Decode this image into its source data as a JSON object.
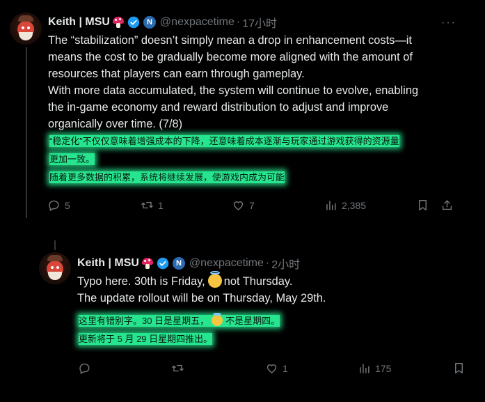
{
  "tweets": [
    {
      "author": {
        "name": "Keith | MSU",
        "handle": "@nexpacetime",
        "separator": "·",
        "time": "17小时",
        "app_badge_letter": "N"
      },
      "body_lines": [
        "The “stabilization” doesn’t simply mean a drop in enhancement costs—it",
        "means the cost to be gradually become more aligned with the amount of",
        "resources that players can earn through gameplay.",
        "With more data accumulated, the system will continue to evolve, enabling",
        "the in-game economy and reward distribution to adjust and improve",
        "organically over time. (7/8)"
      ],
      "translation_lines": [
        "“稳定化”不仅仅意味着增强成本的下降，还意味着成本逐渐与玩家通过游戏获得的资源量",
        "更加一致。",
        "随着更多数据的积累，系统将继续发展，使游戏内成为可能"
      ],
      "actions": {
        "reply": "5",
        "retweet": "1",
        "like": "7",
        "views": "2,385"
      }
    },
    {
      "author": {
        "name": "Keith | MSU",
        "handle": "@nexpacetime",
        "separator": "·",
        "time": "2小时",
        "app_badge_letter": "N"
      },
      "body_part1": "Typo here. 30th is Friday,",
      "body_part2": "not Thursday.",
      "body_line2": "The update rollout will be on Thursday, May 29th.",
      "translation_part1": "这里有错别字。30 日是星期五，",
      "translation_part2": "不是星期四。",
      "translation_line2": "更新将于 5 月 29 日星期四推出。",
      "actions": {
        "reply": "",
        "retweet": "",
        "like": "1",
        "views": "175"
      }
    }
  ],
  "more_glyph": "···",
  "colors": {
    "background": "#000000",
    "text": "#e7e9ea",
    "muted": "#71767b",
    "highlight": "#27e58f",
    "verified": "#1d9bf0",
    "thread_line": "#333639"
  },
  "icons": [
    "mushroom-icon",
    "verified-icon",
    "app-badge-icon",
    "more-icon",
    "reply-icon",
    "retweet-icon",
    "like-icon",
    "views-icon",
    "bookmark-icon",
    "share-icon",
    "halo-emoji-icon"
  ]
}
